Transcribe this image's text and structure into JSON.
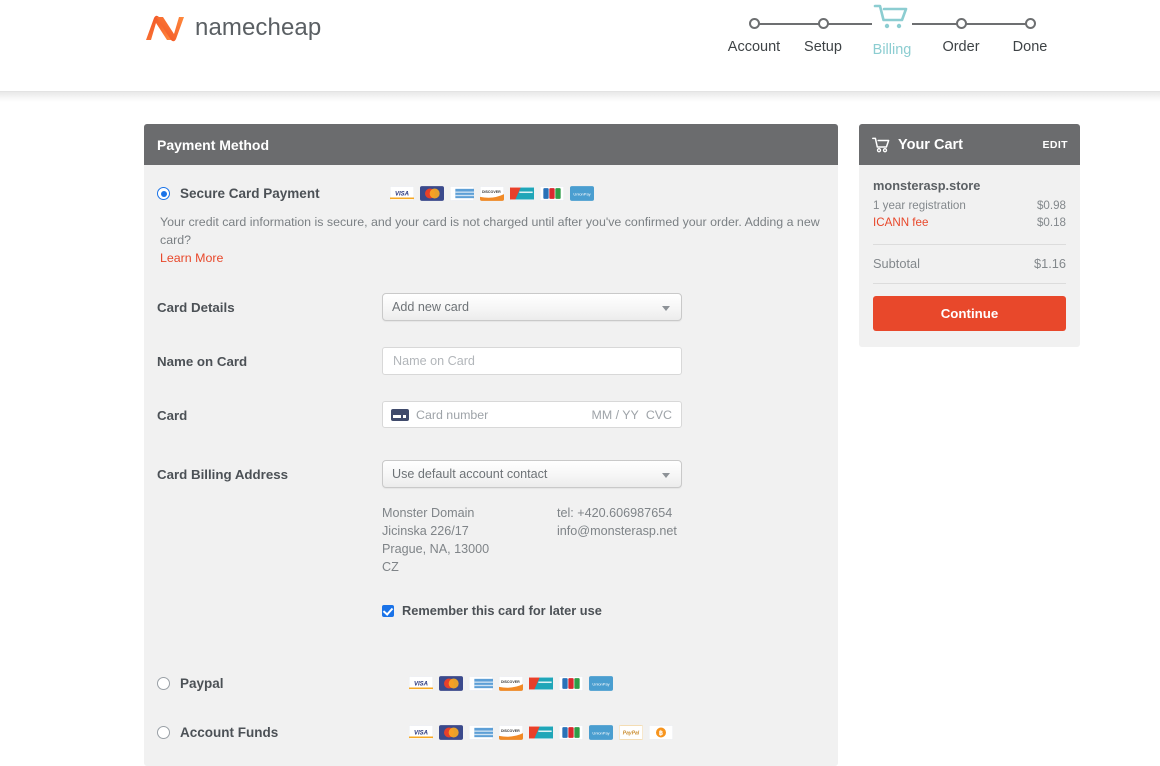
{
  "brand": {
    "name": "namecheap",
    "logo_icon": "namecheap-logo-icon"
  },
  "stepper": {
    "steps": [
      {
        "label": "Account",
        "icon": "step-circle-icon",
        "active": false
      },
      {
        "label": "Setup",
        "icon": "step-diamond-icon",
        "active": false
      },
      {
        "label": "Billing",
        "icon": "shopping-cart-icon",
        "active": true
      },
      {
        "label": "Order",
        "icon": "step-diamond-icon",
        "active": false
      },
      {
        "label": "Done",
        "icon": "step-diamond-icon",
        "active": false
      }
    ]
  },
  "payment_panel": {
    "title": "Payment Method",
    "secure_card": {
      "label": "Secure Card Payment",
      "selected": true,
      "note": "Your credit card information is secure, and your card is not charged until after you've confirmed your order. Adding a new card?",
      "learn_more": "Learn More",
      "card_logos": [
        "visa",
        "mastercard",
        "amex",
        "discover",
        "diners-club",
        "jcb",
        "unionpay"
      ]
    },
    "card_details": {
      "label": "Card Details",
      "selected_value": "Add new card"
    },
    "name_on_card": {
      "label": "Name on Card",
      "value": "",
      "placeholder": "Name on Card"
    },
    "card": {
      "label": "Card",
      "number_placeholder": "Card number",
      "expiry_placeholder": "MM / YY",
      "cvc_placeholder": "CVC",
      "icon": "credit-card-icon"
    },
    "billing_address": {
      "label": "Card Billing Address",
      "selected_value": "Use default account contact",
      "contact_name": "Monster Domain",
      "street": "Jicinska 226/17",
      "city_state_zip": "Prague, NA, 13000",
      "country": "CZ",
      "tel": "tel: +420.606987654",
      "email": "info@monsterasp.net"
    },
    "remember_card": {
      "label": "Remember this card for later use",
      "checked": true
    },
    "paypal": {
      "label": "Paypal",
      "selected": false,
      "card_logos": [
        "visa",
        "mastercard",
        "amex",
        "discover",
        "diners-club",
        "jcb",
        "unionpay"
      ]
    },
    "account_funds": {
      "label": "Account Funds",
      "selected": false,
      "card_logos": [
        "visa",
        "mastercard",
        "amex",
        "discover",
        "diners-club",
        "jcb",
        "unionpay",
        "paypal",
        "bitcoin"
      ]
    }
  },
  "cart": {
    "title": "Your Cart",
    "edit_label": "EDIT",
    "cart_icon": "shopping-cart-icon",
    "domain": "monsterasp.store",
    "items": [
      {
        "name": "1 year registration",
        "price": "$0.98",
        "highlight": false
      },
      {
        "name": "ICANN fee",
        "price": "$0.18",
        "highlight": true
      }
    ],
    "subtotal_label": "Subtotal",
    "subtotal_value": "$1.16",
    "continue_label": "Continue"
  },
  "colors": {
    "accent_orange": "#e8482b",
    "header_gray": "#6b6c6e",
    "panel_bg": "#f1f1f1",
    "active_step": "#8ccdd1",
    "radio_blue": "#1a73e8"
  }
}
